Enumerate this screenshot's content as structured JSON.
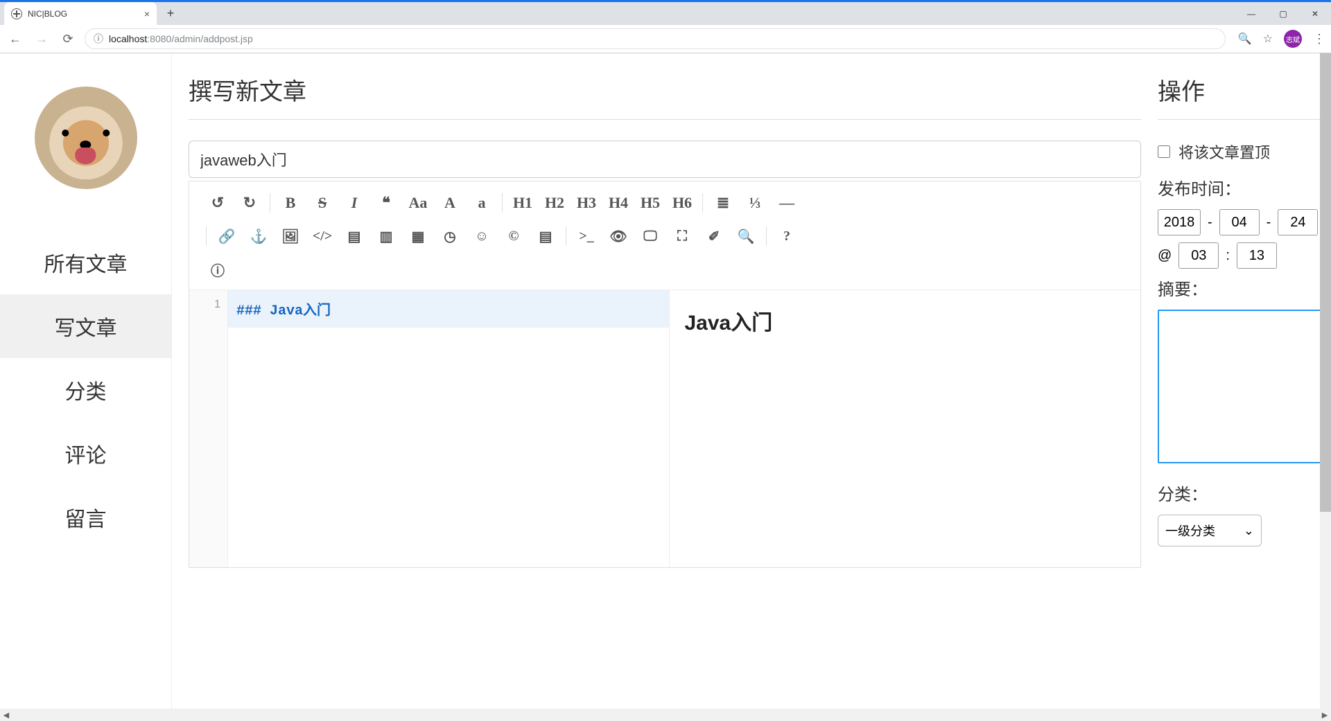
{
  "browser": {
    "tab_title": "NIC|BLOG",
    "url_host": "localhost",
    "url_port": ":8080",
    "url_path": "/admin/addpost.jsp",
    "profile_label": "志斌"
  },
  "sidebar": {
    "items": [
      {
        "label": "所有文章"
      },
      {
        "label": "写文章"
      },
      {
        "label": "分类"
      },
      {
        "label": "评论"
      },
      {
        "label": "留言"
      }
    ]
  },
  "main": {
    "page_title": "撰写新文章",
    "title_value": "javaweb入门",
    "code_hash": "### ",
    "code_text": "Java入门",
    "line_no": "1",
    "preview_heading": "Java入门"
  },
  "toolbar": {
    "undo": "↺",
    "redo": "↻",
    "bold": "B",
    "strike": "S",
    "italic": "I",
    "quote": "❝",
    "aa_big": "Aa",
    "a_up": "A",
    "a_low": "a",
    "h1": "H1",
    "h2": "H2",
    "h3": "H3",
    "h4": "H4",
    "h5": "H5",
    "h6": "H6",
    "ul": "≣",
    "ol": "⅓",
    "hr": "—",
    "link": "🔗",
    "anchor": "⚓",
    "image": "🖼",
    "code": "</>",
    "codeblock": "▤",
    "codeblock2": "▥",
    "table": "▦",
    "clock": "◷",
    "emoji": "☺",
    "copyright": "©",
    "page": "▤",
    "terminal": ">_",
    "eye": "👁",
    "monitor": "🖵",
    "expand": "⛶",
    "eraser": "✐",
    "search": "🔍",
    "help": "?",
    "info": "ⓘ"
  },
  "right": {
    "title": "操作",
    "pin_label": "将该文章置顶",
    "publish_label": "发布时间：",
    "year": "2018",
    "month": "04",
    "day": "24",
    "hour": "03",
    "minute": "13",
    "dash": "-",
    "at": "@",
    "colon": ":",
    "summary_label": "摘要：",
    "summary_value": "",
    "category_label": "分类：",
    "category_selected": "一级分类",
    "chevron": "⌄"
  }
}
